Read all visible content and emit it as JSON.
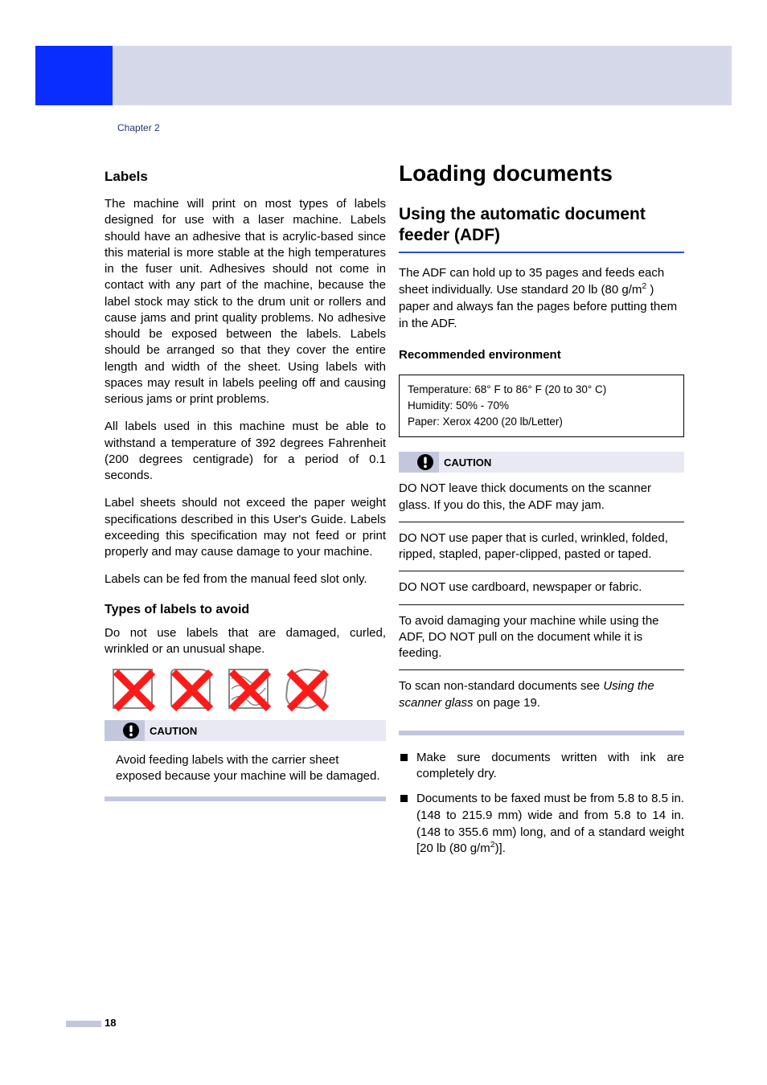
{
  "chapter": "Chapter 2",
  "left": {
    "h_labels": "Labels",
    "p1": "The machine will print on most types of labels designed for use with a laser machine. Labels should have an adhesive that is acrylic-based since this material is more stable at the high temperatures in the fuser unit. Adhesives should not come in contact with any part of the machine, because the label stock may stick to the drum unit or rollers and cause jams and print quality problems. No adhesive should be exposed between the labels. Labels should be arranged so that they cover the entire length and width of the sheet. Using labels with spaces may result in labels peeling off and causing serious jams or print problems.",
    "p2": "All labels used in this machine must be able to withstand a temperature of 392 degrees Fahrenheit (200 degrees centigrade) for a period of 0.1 seconds.",
    "p3": "Label sheets should not exceed the paper weight specifications described in this User's Guide. Labels exceeding this specification may not feed or print properly and may cause damage to your machine.",
    "p4": "Labels can be fed from the manual feed slot only.",
    "h_avoid": "Types of labels to avoid",
    "p5": "Do not use labels that are damaged, curled, wrinkled or an unusual shape.",
    "caution_label": "CAUTION",
    "caution_body": "Avoid feeding labels with the carrier sheet exposed because your machine will be damaged."
  },
  "right": {
    "h1": "Loading documents",
    "h2": "Using the automatic document feeder (ADF)",
    "adf_p_pre": "The ADF can hold up to 35 pages and feeds each sheet individually. Use standard 20 lb (80 g/m",
    "adf_p_post": " ) paper and always fan the pages before putting them in the ADF.",
    "h3_env": "Recommended environment",
    "env_line1": "Temperature: 68° F to 86° F (20 to 30° C)",
    "env_line2": "Humidity: 50% - 70%",
    "env_line3": "Paper: Xerox 4200 (20 lb/Letter)",
    "caution_label": "CAUTION",
    "c1": "DO NOT leave thick documents on the scanner glass. If you do this, the ADF may jam.",
    "c2": "DO NOT use paper that is curled, wrinkled, folded, ripped, stapled, paper-clipped, pasted or taped.",
    "c3": "DO NOT use cardboard, newspaper or fabric.",
    "c4": "To avoid damaging your machine while using the ADF, DO NOT pull on the document while it is feeding.",
    "c5_pre": "To scan non-standard documents see ",
    "c5_ital": "Using the scanner glass",
    "c5_post": " on page 19.",
    "b1": "Make sure documents written with ink are completely dry.",
    "b2_pre": "Documents to be faxed must be from 5.8 to 8.5 in. (148 to 215.9 mm) wide and from 5.8 to 14 in. (148 to 355.6 mm) long, and of a standard weight [20 lb (80 g/m",
    "b2_post": ")]."
  },
  "page_number": "18"
}
